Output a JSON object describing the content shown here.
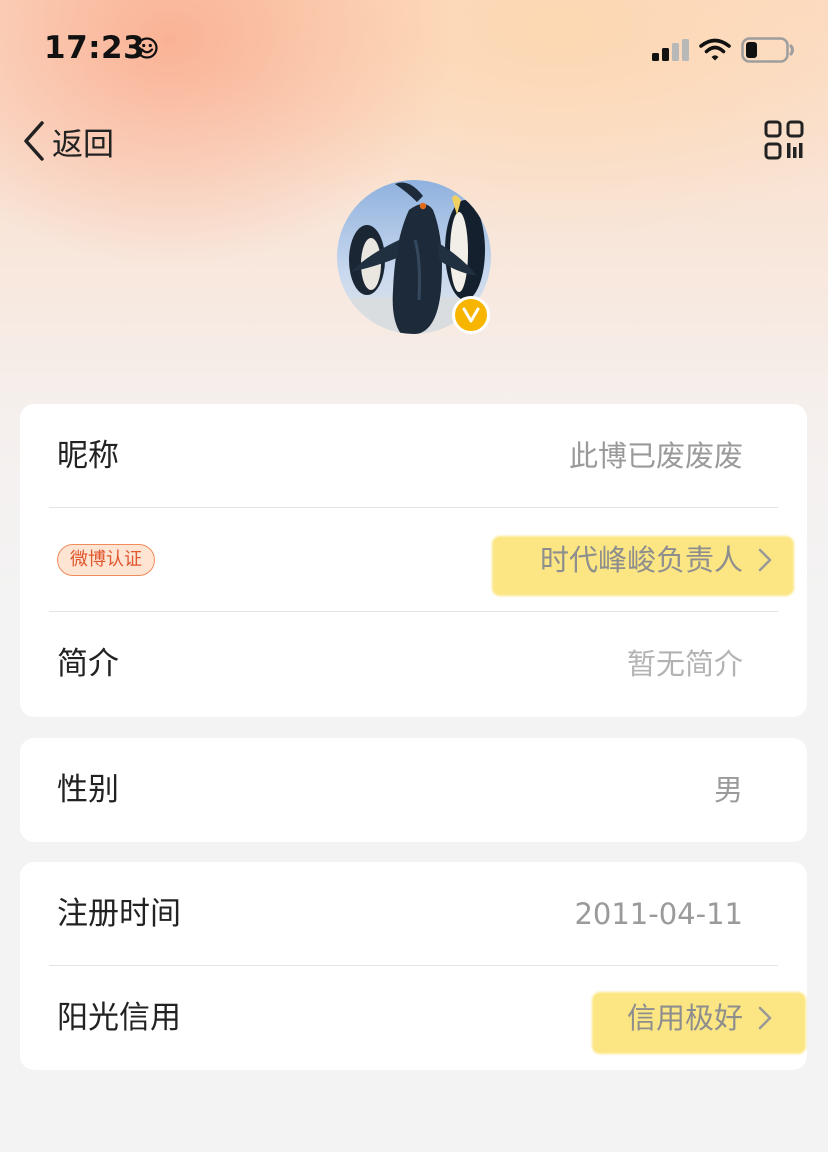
{
  "status_bar": {
    "time": "17:23",
    "icons": [
      "smiley-icon",
      "signal-icon",
      "wifi-icon",
      "battery-icon"
    ]
  },
  "nav": {
    "back_label": "返回",
    "right_icon": "qr-code-icon"
  },
  "avatar": {
    "image": "penguin-avatar",
    "badge_letter": "V",
    "badge_color": "#f7b500"
  },
  "profile": {
    "nickname_label": "昵称",
    "nickname_value": "此博已废废废",
    "verify_tag": "微博认证",
    "verify_value": "时代峰峻负责人",
    "bio_label": "简介",
    "bio_value": "暂无简介",
    "gender_label": "性别",
    "gender_value": "男",
    "register_label": "注册时间",
    "register_value": "2011-04-11",
    "credit_label": "阳光信用",
    "credit_value": "信用极好"
  },
  "colors": {
    "highlight": "#fade5a",
    "tag_text": "#e0562e",
    "value_text": "#9a9a9a"
  }
}
